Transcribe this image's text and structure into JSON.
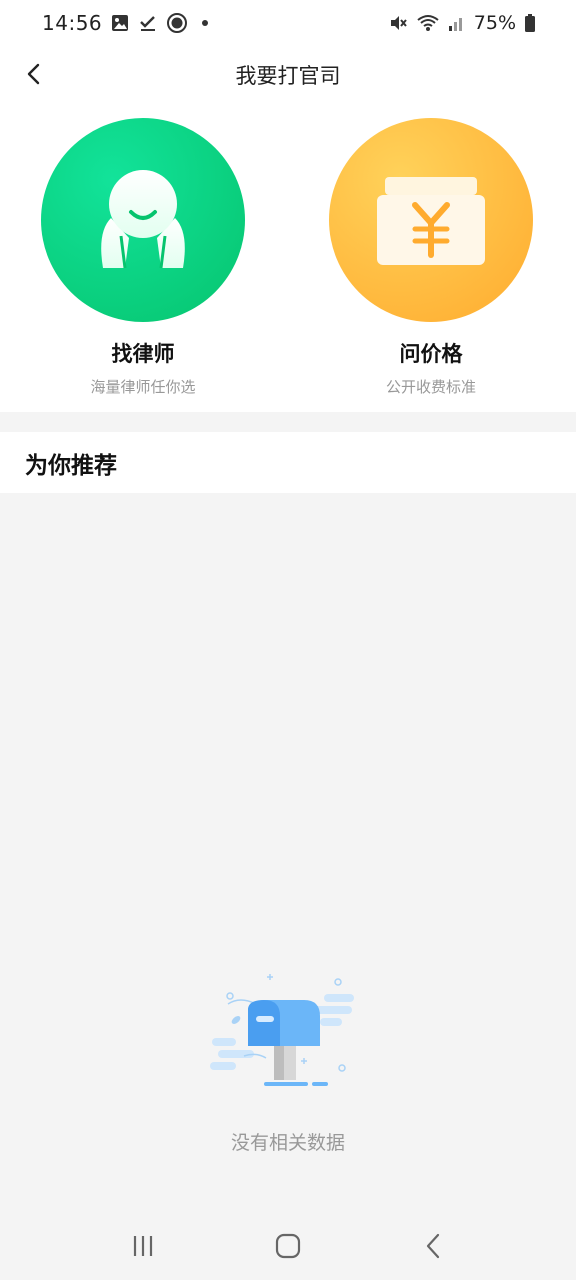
{
  "status": {
    "time": "14:56",
    "battery_pct": "75%",
    "icons_left": [
      "gallery-icon",
      "check-icon",
      "circle-app-icon",
      "dot"
    ],
    "icons_right": [
      "mute-icon",
      "wifi-icon",
      "signal-icon",
      "battery-icon"
    ]
  },
  "nav": {
    "title": "我要打官司"
  },
  "entries": [
    {
      "title": "找律师",
      "subtitle": "海量律师任你选",
      "icon": "lawyer-icon",
      "color": "#06c46e"
    },
    {
      "title": "问价格",
      "subtitle": "公开收费标准",
      "icon": "yen-card-icon",
      "color": "#ffab2e"
    }
  ],
  "recommend": {
    "title": "为你推荐"
  },
  "empty_state": {
    "text": "没有相关数据",
    "icon": "mailbox-icon"
  },
  "system_nav": [
    "recents-button",
    "home-button",
    "back-button"
  ]
}
